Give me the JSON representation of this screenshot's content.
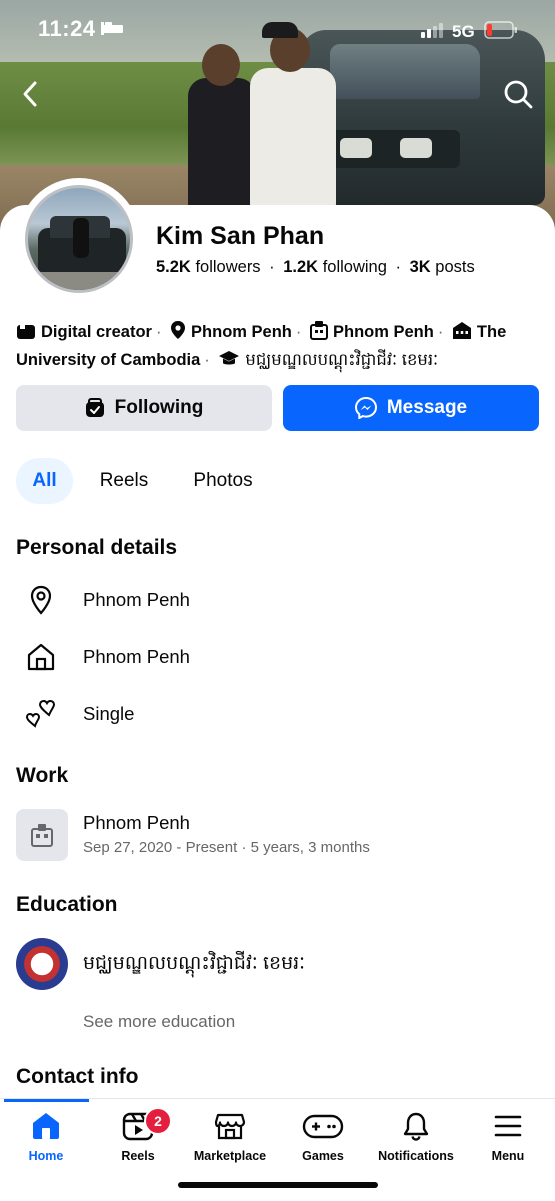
{
  "status": {
    "time": "11:24",
    "network": "5G"
  },
  "profile": {
    "name": "Kim San Phan",
    "followers_count": "5.2K",
    "followers_label": "followers",
    "following_count": "1.2K",
    "following_label": "following",
    "posts_count": "3K",
    "posts_label": "posts"
  },
  "intro": {
    "category": "Digital creator",
    "current_city": "Phnom Penh",
    "workplace": "Phnom Penh",
    "school_prefix": "The",
    "school_rest": "University of Cambodia",
    "education_khmer": "មជ្ឈមណ្ឌលបណ្តុះវិជ្ជាជីវៈ ខេមរៈ"
  },
  "actions": {
    "following_label": "Following",
    "message_label": "Message"
  },
  "tabs": [
    {
      "label": "All"
    },
    {
      "label": "Reels"
    },
    {
      "label": "Photos"
    }
  ],
  "personal_details": {
    "title": "Personal details",
    "items": [
      {
        "icon": "location-pin-icon",
        "text": "Phnom Penh"
      },
      {
        "icon": "home-icon",
        "text": "Phnom Penh"
      },
      {
        "icon": "hearts-icon",
        "text": "Single"
      }
    ]
  },
  "work": {
    "title": "Work",
    "employer": "Phnom Penh",
    "duration": "Sep 27, 2020 - Present · 5 years, 3 months"
  },
  "education": {
    "title": "Education",
    "school": "មជ្ឈមណ្ឌលបណ្តុះវិជ្ជាជីវៈ ខេមរៈ",
    "see_more": "See more education"
  },
  "contact": {
    "title": "Contact info"
  },
  "tabbar": {
    "items": [
      {
        "label": "Home",
        "icon": "home-icon"
      },
      {
        "label": "Reels",
        "icon": "reels-icon",
        "badge": "2"
      },
      {
        "label": "Marketplace",
        "icon": "marketplace-icon"
      },
      {
        "label": "Games",
        "icon": "gamepad-icon"
      },
      {
        "label": "Notifications",
        "icon": "bell-icon"
      },
      {
        "label": "Menu",
        "icon": "menu-icon"
      }
    ]
  },
  "colors": {
    "accent": "#0866ff",
    "badge": "#e41e3f",
    "muted": "#65676b",
    "chip": "#e4e6eb"
  }
}
